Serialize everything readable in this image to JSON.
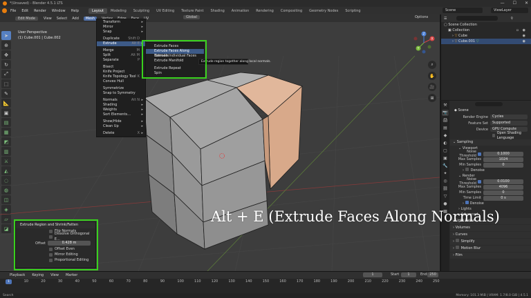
{
  "window": {
    "title": "*(Unsaved) - Blender 4.5.1 LTS",
    "controls": [
      "—",
      "☐",
      "✕"
    ]
  },
  "menubar": {
    "items": [
      "File",
      "Edit",
      "Render",
      "Window",
      "Help"
    ],
    "workspaces": [
      "Layout",
      "Modeling",
      "Sculpting",
      "UV Editing",
      "Texture Paint",
      "Shading",
      "Animation",
      "Rendering",
      "Compositing",
      "Geometry Nodes",
      "Scripting"
    ],
    "active_workspace": "Layout",
    "scene": "Scene",
    "view_layer": "ViewLayer"
  },
  "viewport": {
    "mode": "Edit Mode",
    "menus": [
      "View",
      "Select",
      "Add",
      "Mesh",
      "Vertex",
      "Edge",
      "Face",
      "UV"
    ],
    "active_menu": "Mesh",
    "transform_orientation": "Global",
    "options": "Options",
    "info_line1": "User Perspective",
    "info_line2": "(1) Cube.001 | Cube.002",
    "gizmo_axes": {
      "x": "X",
      "y": "Y",
      "z": "Z"
    }
  },
  "mesh_menu": {
    "items": [
      {
        "label": "Transform",
        "sub": true
      },
      {
        "label": "Mirror",
        "sub": true
      },
      {
        "label": "Snap",
        "sub": true
      },
      {
        "sep": true
      },
      {
        "label": "Duplicate",
        "shortcut": "Shift D"
      },
      {
        "label": "Extrude",
        "shortcut": "Alt E",
        "sub": true,
        "hl": true
      },
      {
        "sep": true
      },
      {
        "label": "Merge",
        "shortcut": "M"
      },
      {
        "label": "Split",
        "shortcut": "Alt M"
      },
      {
        "label": "Separate",
        "shortcut": "P"
      },
      {
        "sep": true
      },
      {
        "label": "Bisect"
      },
      {
        "label": "Knife Project"
      },
      {
        "label": "Knife Topology Tool",
        "shortcut": "K"
      },
      {
        "label": "Convex Hull"
      },
      {
        "sep": true
      },
      {
        "label": "Symmetrize"
      },
      {
        "label": "Snap to Symmetry"
      },
      {
        "sep": true
      },
      {
        "label": "Normals",
        "shortcut": "Alt N",
        "sub": true
      },
      {
        "label": "Shading",
        "sub": true
      },
      {
        "label": "Weights",
        "sub": true
      },
      {
        "label": "Sort Elements...",
        "sub": true
      },
      {
        "sep": true
      },
      {
        "label": "Show/Hide",
        "sub": true
      },
      {
        "label": "Clean Up",
        "sub": true
      },
      {
        "sep": true
      },
      {
        "label": "Delete",
        "shortcut": "X",
        "sub": true
      }
    ]
  },
  "extrude_submenu": {
    "items": [
      {
        "label": "Extrude Faces"
      },
      {
        "label": "Extrude Faces Along Normals",
        "hl": true
      },
      {
        "label": "Extrude Individual Faces"
      },
      {
        "label": "Extrude Manifold"
      },
      {
        "sep": true
      },
      {
        "label": "Extrude Repeat"
      },
      {
        "label": "Spin"
      }
    ],
    "tooltip": "Extrude region together along local normals."
  },
  "redo_panel": {
    "title": "Extrude Region and Shrink/Fatten",
    "options_top": [
      "Flip Normals",
      "Dissolve Orthogonal E..."
    ],
    "offset_label": "Offset",
    "offset_value": "0.428 m",
    "options_bottom": [
      "Offset Even",
      "Mirror Editing",
      "Proportional Editing"
    ]
  },
  "caption": "Alt + E (Extrude Faces Along Normals)",
  "outliner": {
    "rows": [
      {
        "label": "Scene Collection",
        "indent": 0
      },
      {
        "label": "Collection",
        "indent": 1
      },
      {
        "label": "Cube",
        "indent": 2
      },
      {
        "label": "Cube.001",
        "indent": 2,
        "selected": true
      }
    ]
  },
  "properties": {
    "scene_label": "Scene",
    "render_engine_label": "Render Engine",
    "render_engine": "Cycles",
    "feature_set_label": "Feature Set",
    "feature_set": "Supported",
    "device_label": "Device",
    "device": "GPU Compute",
    "osl_label": "Open Shading Language",
    "sampling": "Sampling",
    "viewport": "Viewport",
    "vp_noise_label": "Noise Threshold",
    "vp_noise": "0.1000",
    "vp_max_label": "Max Samples",
    "vp_max": "1024",
    "vp_min_label": "Min Samples",
    "vp_min": "0",
    "denoise": "Denoise",
    "render": "Render",
    "r_noise_label": "Noise Threshold",
    "r_noise": "0.0100",
    "r_max_label": "Max Samples",
    "r_max": "4096",
    "r_min_label": "Min Samples",
    "r_min": "0",
    "time_limit_label": "Time Limit",
    "time_limit": "0 s",
    "denoise2": "Denoise",
    "lights": "Lights",
    "advanced": "Advanced",
    "light_paths": "Light Paths",
    "volumes": "Volumes",
    "curves": "Curves",
    "simplify": "Simplify",
    "motion_blur": "Motion Blur",
    "film": "Film"
  },
  "timeline": {
    "menus": [
      "Playback",
      "Keying",
      "View",
      "Marker"
    ],
    "current_frame": "1",
    "start_label": "Start",
    "start": "1",
    "end_label": "End",
    "end": "250",
    "ticks": [
      "1",
      "10",
      "20",
      "30",
      "40",
      "50",
      "60",
      "70",
      "80",
      "90",
      "100",
      "110",
      "120",
      "130",
      "140",
      "150",
      "160",
      "170",
      "180",
      "190",
      "200",
      "210",
      "220",
      "230",
      "240",
      "250"
    ]
  },
  "statusbar": {
    "left": "Search",
    "right": "Memory: 101.3 MiB | VRAM: 1.7/8.0 GiB | 4.5.1"
  },
  "colors": {
    "accent": "#4d74b8",
    "highlight_box": "#39d11d",
    "selected_face": "#d8a98a",
    "blender_orange": "#e87d0d"
  }
}
